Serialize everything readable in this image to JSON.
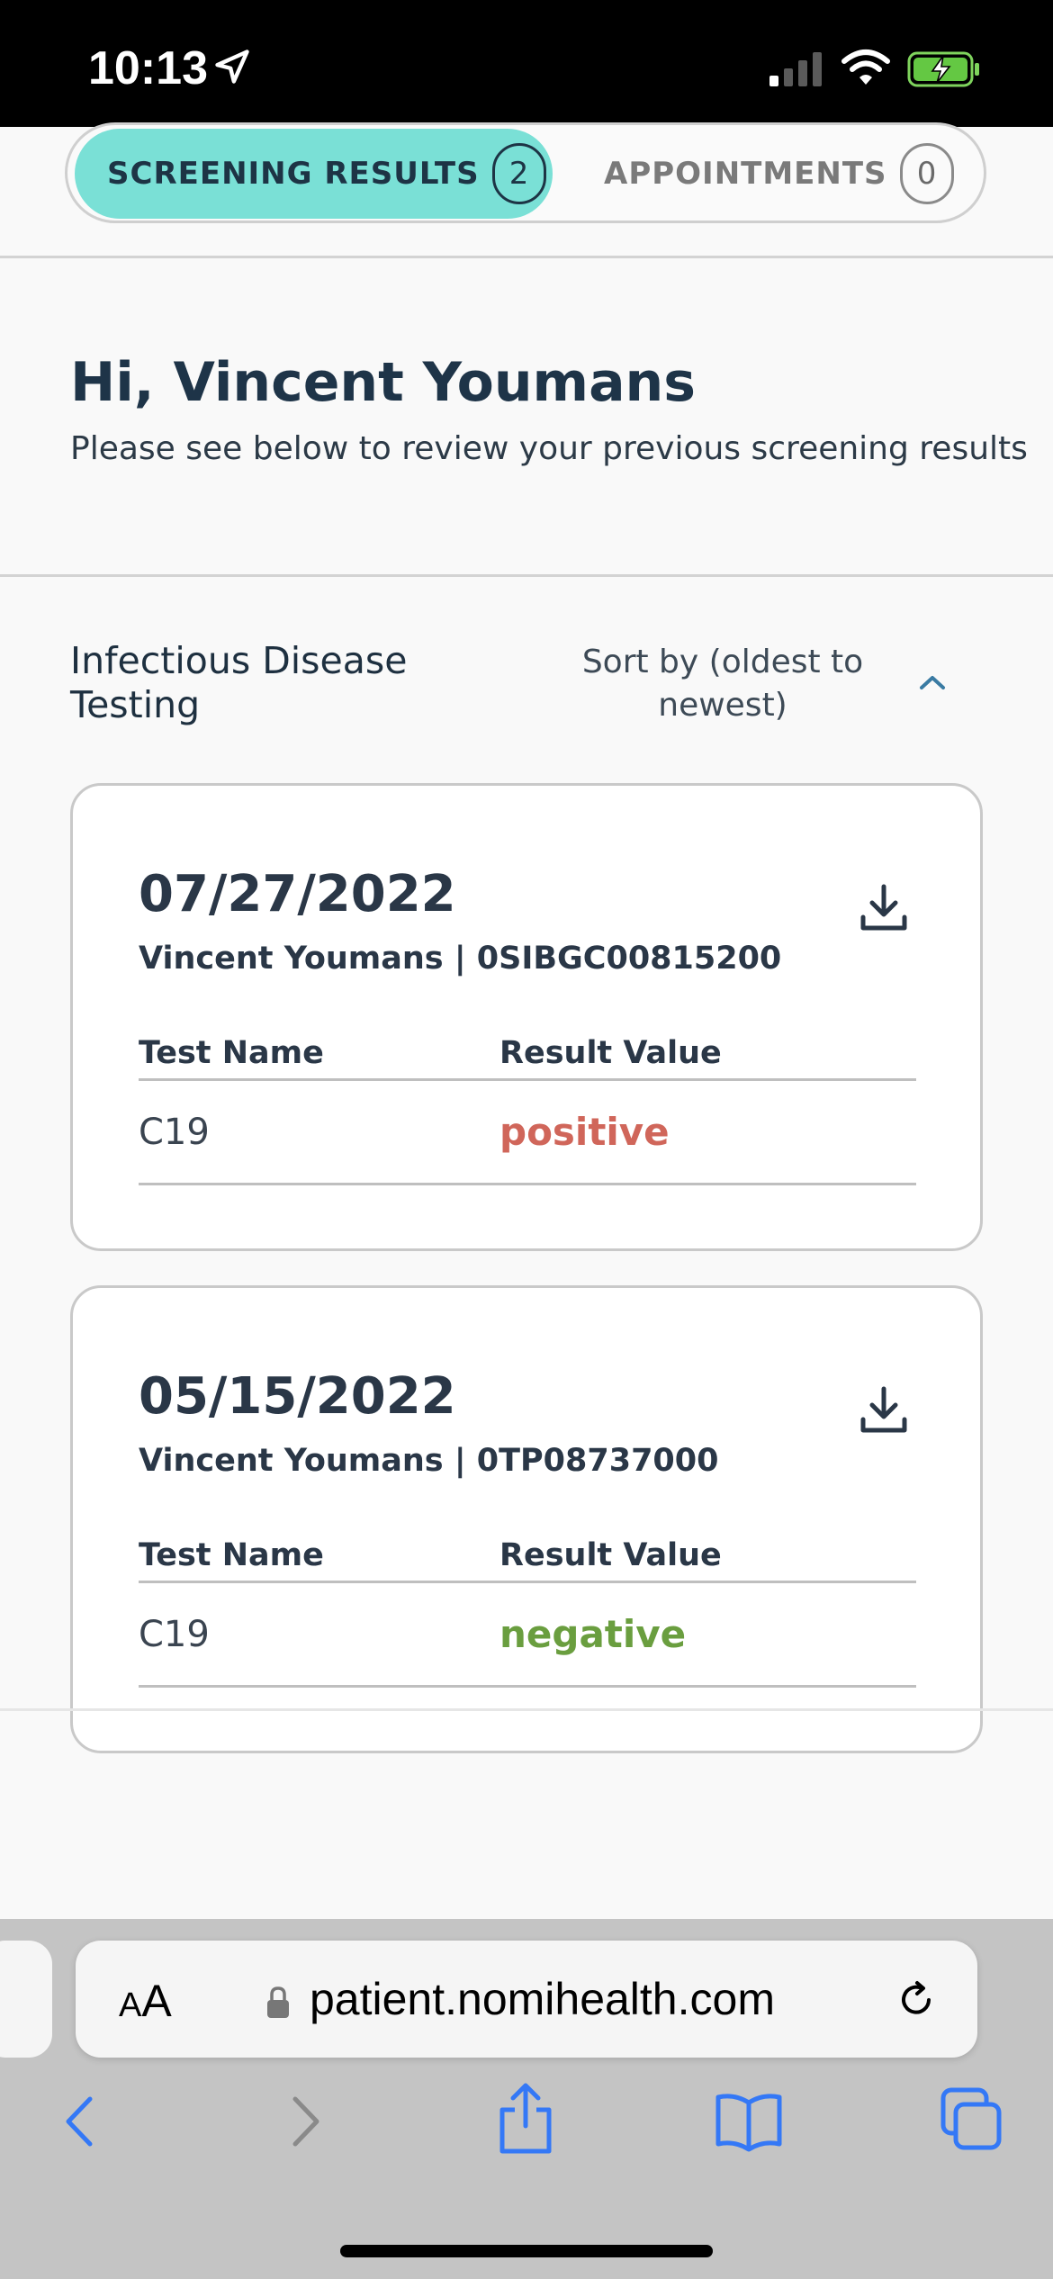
{
  "status_bar": {
    "time": "10:13"
  },
  "tabs": [
    {
      "label": "SCREENING RESULTS",
      "count": "2",
      "active": true
    },
    {
      "label": "APPOINTMENTS",
      "count": "0",
      "active": false
    }
  ],
  "header": {
    "greeting": "Hi, Vincent Youmans",
    "subtitle": "Please see below to review your previous screening results"
  },
  "section": {
    "title": "Infectious Disease Testing",
    "sort_label": "Sort by (oldest to newest)"
  },
  "results": [
    {
      "date": "07/27/2022",
      "meta": "Vincent Youmans | 0SIBGC00815200",
      "col_test_name": "Test Name",
      "col_result_value": "Result Value",
      "test_name": "C19",
      "result_value": "positive",
      "result_color": "#d0665a"
    },
    {
      "date": "05/15/2022",
      "meta": "Vincent Youmans | 0TP08737000",
      "col_test_name": "Test Name",
      "col_result_value": "Result Value",
      "test_name": "C19",
      "result_value": "negative",
      "result_color": "#6a9e3f"
    }
  ],
  "browser": {
    "text_size_label_small": "A",
    "text_size_label_big": "A",
    "url": "patient.nomihealth.com"
  },
  "colors": {
    "accent": "#7ae0d6",
    "positive": "#d0665a",
    "negative": "#6a9e3f",
    "ios_blue": "#3478f6"
  },
  "icons": [
    "location-arrow-icon",
    "cellular-signal-icon",
    "wifi-icon",
    "battery-charging-icon",
    "chevron-up-icon",
    "download-icon",
    "lock-icon",
    "reload-icon",
    "back-icon",
    "forward-icon",
    "share-icon",
    "bookmarks-icon",
    "tabs-icon"
  ]
}
